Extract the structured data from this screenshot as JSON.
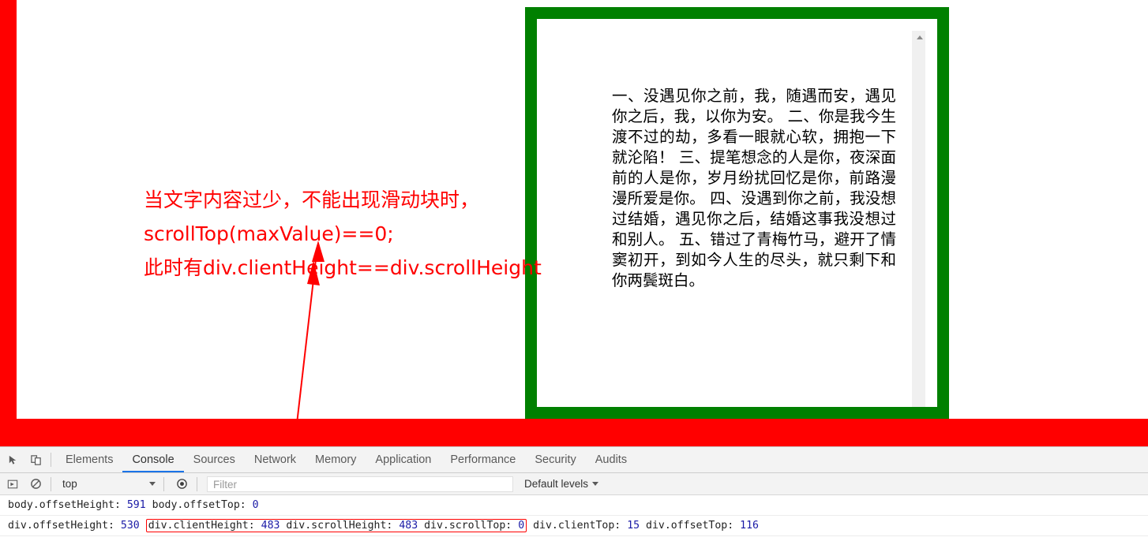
{
  "page": {
    "background_color": "#ff0000",
    "content_background": "#ffffff"
  },
  "scroll_box": {
    "border_color": "#008000",
    "border_width_px": 15,
    "text": "一、没遇见你之前，我，随遇而安，遇见你之后，我，以你为安。 二、你是我今生渡不过的劫，多看一眼就心软，拥抱一下就沦陷！ 三、提笔想念的人是你，夜深面前的人是你，岁月纷扰回忆是你，前路漫漫所爱是你。 四、没遇到你之前，我没想过结婚，遇见你之后，结婚这事我没想过和别人。 五、错过了青梅竹马，避开了情窦初开，到如今人生的尽头，就只剩下和你两鬓斑白。",
    "scrollbar": {
      "has_thumb": false,
      "up_arrow": "▲"
    }
  },
  "annotation": {
    "color": "#ff0000",
    "lines": [
      "当文字内容过少，不能出现滑动块时，",
      "scrollTop(maxValue)==0;",
      "此时有div.clientHeight==div.scrollHeight"
    ]
  },
  "devtools": {
    "toolbar_icons": [
      {
        "name": "inspect-element-icon",
        "glyph": "⬉"
      },
      {
        "name": "device-toolbar-icon",
        "glyph": "▯"
      }
    ],
    "tabs": [
      {
        "label": "Elements",
        "active": false
      },
      {
        "label": "Console",
        "active": true
      },
      {
        "label": "Sources",
        "active": false
      },
      {
        "label": "Network",
        "active": false
      },
      {
        "label": "Memory",
        "active": false
      },
      {
        "label": "Application",
        "active": false
      },
      {
        "label": "Performance",
        "active": false
      },
      {
        "label": "Security",
        "active": false
      },
      {
        "label": "Audits",
        "active": false
      }
    ],
    "filterbar": {
      "execute_icon": "execute-arrow-icon",
      "clear_icon": "clear-console-icon",
      "context_value": "top",
      "eye_icon": "live-expression-eye-icon",
      "filter_placeholder": "Filter",
      "filter_value": "",
      "levels_label": "Default levels"
    },
    "console_rows": [
      {
        "segments": [
          {
            "text": "body.offsetHeight: ",
            "kind": "text"
          },
          {
            "text": "591",
            "kind": "num"
          },
          {
            "text": " body.offsetTop: ",
            "kind": "text"
          },
          {
            "text": "0",
            "kind": "num"
          }
        ]
      },
      {
        "segments": [
          {
            "text": "div.offsetHeight: ",
            "kind": "text"
          },
          {
            "text": "530",
            "kind": "num"
          },
          {
            "text": " ",
            "kind": "text"
          },
          {
            "text": "BOX_START",
            "kind": "boxstart"
          },
          {
            "text": "div.clientHeight: ",
            "kind": "text"
          },
          {
            "text": "483",
            "kind": "num"
          },
          {
            "text": " div.scrollHeight: ",
            "kind": "text"
          },
          {
            "text": "483",
            "kind": "num"
          },
          {
            "text": " div.scrollTop: ",
            "kind": "text"
          },
          {
            "text": "0",
            "kind": "num"
          },
          {
            "text": "BOX_END",
            "kind": "boxend"
          },
          {
            "text": " div.clientTop: ",
            "kind": "text"
          },
          {
            "text": "15",
            "kind": "num"
          },
          {
            "text": " div.offsetTop: ",
            "kind": "text"
          },
          {
            "text": "116",
            "kind": "num"
          }
        ]
      }
    ]
  }
}
